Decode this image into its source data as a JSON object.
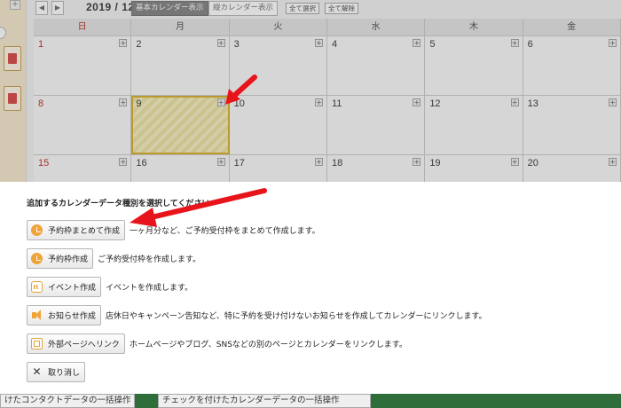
{
  "calendar": {
    "month_label": "2019 / 12",
    "prev_label": "◀",
    "next_label": "▶",
    "view_buttons": {
      "basic": "基本カレンダー表示",
      "vertical": "縦カレンダー表示",
      "select_all": "全て選択",
      "clear_all": "全て解除"
    },
    "weekdays": [
      "日",
      "月",
      "火",
      "水",
      "木",
      "金"
    ],
    "weeks": [
      [
        "1",
        "2",
        "3",
        "4",
        "5",
        "6"
      ],
      [
        "8",
        "9",
        "10",
        "11",
        "12",
        "13"
      ],
      [
        "15",
        "16",
        "17",
        "18",
        "19",
        "20"
      ]
    ],
    "plus_label": "+"
  },
  "dialog": {
    "prompt": "追加するカレンダーデータ種別を選択してください",
    "options": [
      {
        "label": "予約枠まとめて作成",
        "desc": "一ヶ月分など、ご予約受付枠をまとめて作成します。",
        "icon": "bulk-reservation-icon"
      },
      {
        "label": "予約枠作成",
        "desc": "ご予約受付枠を作成します。",
        "icon": "reservation-icon"
      },
      {
        "label": "イベント作成",
        "desc": "イベントを作成します。",
        "icon": "event-calendar-icon"
      },
      {
        "label": "お知らせ作成",
        "desc": "店休日やキャンペーン告知など、特に予約を受け付けないお知らせを作成してカレンダーにリンクします。",
        "icon": "megaphone-icon"
      },
      {
        "label": "外部ページへリンク",
        "desc": "ホームページやブログ、SNSなどの別のページとカレンダーをリンクします。",
        "icon": "external-link-icon"
      }
    ],
    "cancel_label": "取り消し"
  },
  "bottom_bar": {
    "left_label": "けたコンタクトデータの一括操作",
    "right_label": "チェックを付けたカレンダーデータの一括操作"
  },
  "colors": {
    "accent_arrow": "#e8141b",
    "today_highlight": "#d9b437",
    "icon_orange": "#f0a338"
  }
}
